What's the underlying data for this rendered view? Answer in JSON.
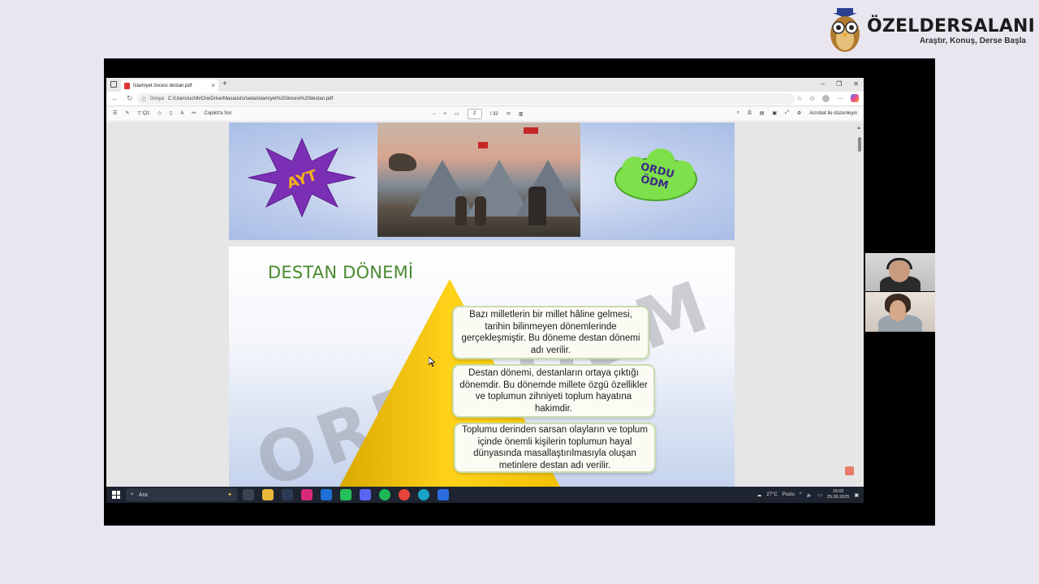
{
  "brand": {
    "name": "ÖZELDERSALANI",
    "tagline": "Araştır, Konuş, Derse Başla"
  },
  "browser": {
    "tab_title": "İslamiyet öncesi destan.pdf",
    "address": {
      "scheme_label": "Dosya",
      "url": "C:/Users/uchih/OneDrive/Masaüstü/seda/islamiyet%20öncesi%20destan.pdf"
    },
    "pdf_toolbar": {
      "draw_label": "Çiz",
      "copilot_label": "Copilot'a Sor",
      "page_current": "2",
      "page_total": "/ 32",
      "acrobat_label": "Acrobat ile düzenleyin"
    }
  },
  "slide1": {
    "star_text": "AYT",
    "cloud_line1": "ORDU",
    "cloud_line2": "ÖDM"
  },
  "slide2": {
    "title": "DESTAN DÖNEMİ",
    "watermark": "ORDU ÖDM",
    "boxes": [
      "Bazı milletlerin bir millet hâline gelmesi, tarihin bilinmeyen dönemlerinde gerçekleşmiştir. Bu döneme destan dönemi adı verilir.",
      "Destan dönemi, destanların ortaya çıktığı dönemdir. Bu dönemde millete özgü özellikler ve toplumun zihniyeti toplum hayatına hakimdir.",
      "Toplumu derinden sarsan olayların ve toplum içinde önemli kişilerin toplumun hayal dünyasında masallaştırılmasıyla oluşan metinlere destan adı verilir."
    ]
  },
  "taskbar": {
    "search_placeholder": "Ara",
    "weather": "27°C",
    "weather_desc": "Puslu",
    "time": "16:02",
    "date": "25.09.2025"
  },
  "colors": {
    "title_green": "#4a8a2e",
    "pyramid_yellow": "#f2c300",
    "star_purple": "#7b2fb5",
    "cloud_green": "#7ee04a"
  }
}
